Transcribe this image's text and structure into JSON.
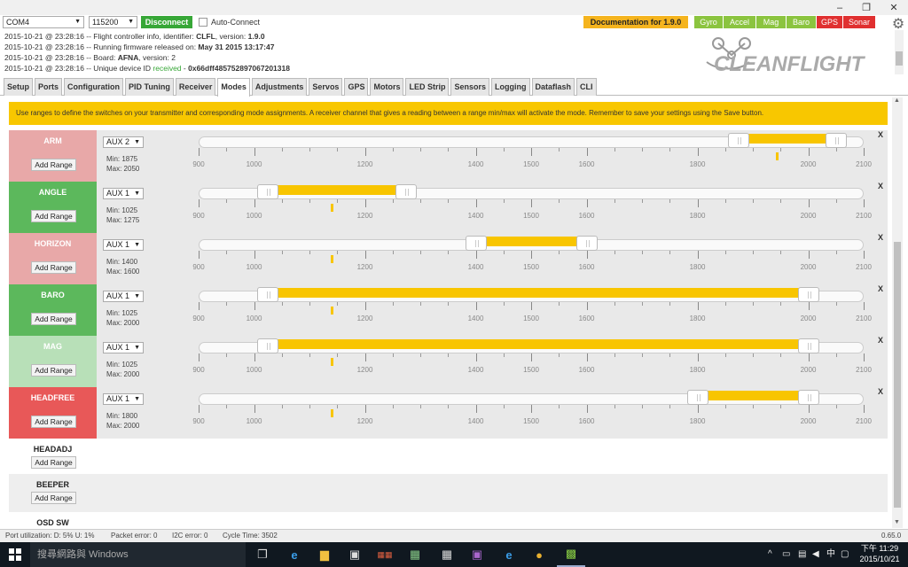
{
  "window": {
    "minimize": "–",
    "restore": "❐",
    "close": "✕"
  },
  "header": {
    "port": "COM4",
    "baud": "115200",
    "disconnect": "Disconnect",
    "auto_connect": "Auto-Connect",
    "documentation": "Documentation for 1.9.0",
    "sensors": [
      {
        "name": "Gyro",
        "color": "#8bc43f"
      },
      {
        "name": "Accel",
        "color": "#8bc43f"
      },
      {
        "name": "Mag",
        "color": "#8bc43f"
      },
      {
        "name": "Baro",
        "color": "#8bc43f"
      },
      {
        "name": "GPS",
        "color": "#e03030"
      },
      {
        "name": "Sonar",
        "color": "#e03030"
      }
    ]
  },
  "log": [
    {
      "a": "2015-10-21 @ 23:28:16 -- Flight controller info, identifier: ",
      "b": "CLFL",
      "c": ", version: ",
      "d": "1.9.0",
      "e": ""
    },
    {
      "a": "2015-10-21 @ 23:28:16 -- Running firmware released on: ",
      "b": "May 31 2015 13:17:47",
      "c": "",
      "d": "",
      "e": ""
    },
    {
      "a": "2015-10-21 @ 23:28:16 -- Board: ",
      "b": "AFNA",
      "c": ", version: ",
      "d": "2",
      "e": ""
    },
    {
      "a": "2015-10-21 @ 23:28:16 -- Unique device ID ",
      "b": "",
      "c": "received",
      "d": " - ",
      "e": "0x66dff485752897067201318"
    }
  ],
  "logo_text": "CLEANFLIGHT",
  "tabs": [
    "Setup",
    "Ports",
    "Configuration",
    "PID Tuning",
    "Receiver",
    "Modes",
    "Adjustments",
    "Servos",
    "GPS",
    "Motors",
    "LED Strip",
    "Sensors",
    "Logging",
    "Dataflash",
    "CLI"
  ],
  "active_tab": "Modes",
  "notice": "Use ranges to define the switches on your transmitter and corresponding mode assignments. A receiver channel that gives a reading between a range min/max will activate the mode. Remember to save your settings using the Save button.",
  "scale": {
    "min": 900,
    "max": 2100,
    "labels": [
      "900",
      "1000",
      "1200",
      "1400",
      "1500",
      "1600",
      "1800",
      "2000",
      "2100"
    ]
  },
  "modes": [
    {
      "name": "ARM",
      "color": "#e8a8a8",
      "aux": "AUX 2",
      "min_label": "Min: 1875",
      "max_label": "Max: 2050",
      "min": 1875,
      "max": 2050,
      "reading": 1943,
      "add": "Add Range",
      "remove": "X"
    },
    {
      "name": "ANGLE",
      "color": "#5cb85c",
      "aux": "AUX 1",
      "min_label": "Min: 1025",
      "max_label": "Max: 1275",
      "min": 1025,
      "max": 1275,
      "reading": 1140,
      "add": "Add Range",
      "remove": "X"
    },
    {
      "name": "HORIZON",
      "color": "#e8a8a8",
      "aux": "AUX 1",
      "min_label": "Min: 1400",
      "max_label": "Max: 1600",
      "min": 1400,
      "max": 1600,
      "reading": 1140,
      "add": "Add Range",
      "remove": "X"
    },
    {
      "name": "BARO",
      "color": "#5cb85c",
      "aux": "AUX 1",
      "min_label": "Min: 1025",
      "max_label": "Max: 2000",
      "min": 1025,
      "max": 2000,
      "reading": 1140,
      "add": "Add Range",
      "remove": "X"
    },
    {
      "name": "MAG",
      "color": "#b8e0b8",
      "aux": "AUX 1",
      "min_label": "Min: 1025",
      "max_label": "Max: 2000",
      "min": 1025,
      "max": 2000,
      "reading": 1140,
      "add": "Add Range",
      "remove": "X"
    },
    {
      "name": "HEADFREE",
      "color": "#e85858",
      "aux": "AUX 1",
      "min_label": "Min: 1800",
      "max_label": "Max: 2000",
      "min": 1800,
      "max": 2000,
      "reading": 1140,
      "add": "Add Range",
      "remove": "X"
    }
  ],
  "empty_modes": [
    {
      "name": "HEADADJ",
      "add": "Add Range"
    },
    {
      "name": "BEEPER",
      "add": "Add Range"
    },
    {
      "name": "OSD SW",
      "add": ""
    }
  ],
  "status": {
    "port": "Port utilization: D: 5% U: 1%",
    "packet": "Packet error: 0",
    "i2c": "I2C error: 0",
    "cycle": "Cycle Time: 3502",
    "version": "0.65.0"
  },
  "taskbar": {
    "search": "搜尋網路與 Windows",
    "time": "下午 11:29",
    "date": "2015/10/21"
  }
}
